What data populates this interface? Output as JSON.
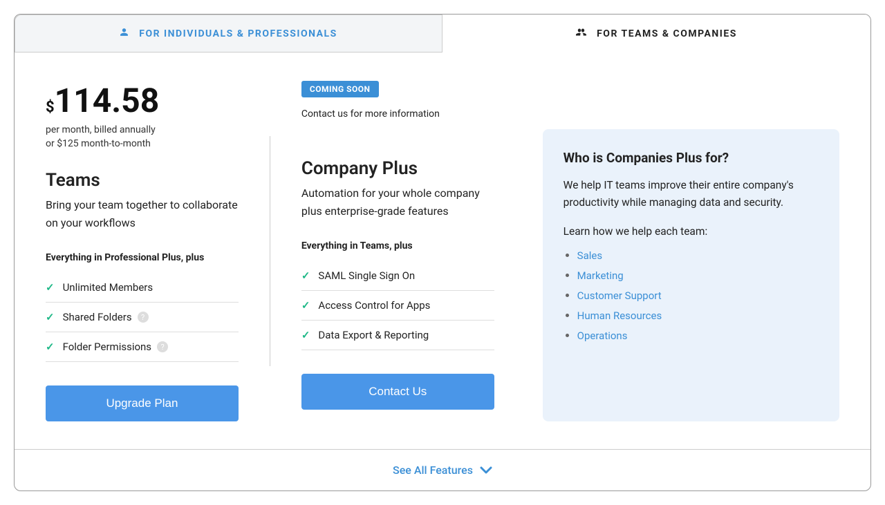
{
  "tabs": {
    "individuals": "For Individuals & Professionals",
    "teams_companies": "For Teams & Companies"
  },
  "teams": {
    "currency": "$",
    "price": "114.58",
    "price_sub": "per month, billed annually",
    "price_alt": "or $125 month-to-month",
    "title": "Teams",
    "desc": "Bring your team together to collaborate on your workflows",
    "includes_head": "Everything in Professional Plus, plus",
    "features": {
      "f0": "Unlimited Members",
      "f1": "Shared Folders",
      "f2": "Folder Permissions"
    },
    "cta": "Upgrade Plan"
  },
  "company": {
    "badge": "Coming Soon",
    "contact_line": "Contact us for more information",
    "title": "Company Plus",
    "desc": "Automation for your whole company plus enterprise-grade features",
    "includes_head": "Everything in Teams, plus",
    "features": {
      "f0": "SAML Single Sign On",
      "f1": "Access Control for Apps",
      "f2": "Data Export & Reporting"
    },
    "cta": "Contact Us"
  },
  "side": {
    "title": "Who is Companies Plus for?",
    "text": "We help IT teams improve their entire company's productivity while managing data and security.",
    "subhead": "Learn how we help each team:",
    "links": {
      "l0": "Sales",
      "l1": "Marketing",
      "l2": "Customer Support",
      "l3": "Human Resources",
      "l4": "Operations"
    }
  },
  "footer": {
    "see_all": "See All Features"
  }
}
